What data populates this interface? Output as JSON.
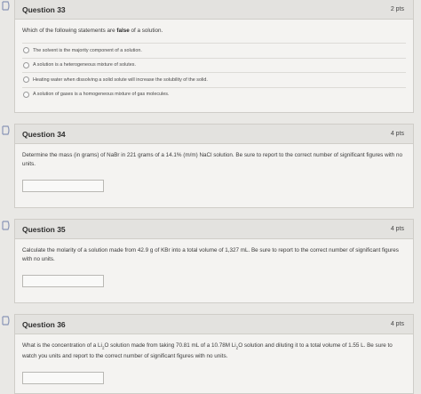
{
  "questions": [
    {
      "title": "Question 33",
      "points": "2 pts",
      "text_pre": "Which of the following statements are ",
      "text_bold": "false",
      "text_post": " of a solution.",
      "options": [
        "The solvent is the majority component of a solution.",
        "A solution is a heterogeneous mixture of solutes.",
        "Heating water when dissolving a solid solute will increase the solubility of the solid.",
        "A solution of gases is a homogeneous mixture of gas molecules."
      ]
    },
    {
      "title": "Question 34",
      "points": "4 pts",
      "text": "Determine the mass (in grams) of NaBr in 221 grams of a 14.1% (m/m) NaCl solution.  Be sure to report to the correct number of significant figures with no units."
    },
    {
      "title": "Question 35",
      "points": "4 pts",
      "text": "Calculate the molarity of a solution made from 42.9 g of KBr into a total volume of 1,327 mL.  Be sure to report to the correct number of significant figures with no units."
    },
    {
      "title": "Question 36",
      "points": "4 pts",
      "text_a": "What is the concentration of a Li",
      "sub_a": "2",
      "text_b": "O solution made from taking 70.81 mL of a 10.78M Li",
      "sub_b": "2",
      "text_c": "O solution and diluting it to a total volume of 1.55 L.  Be sure to watch you units and report to the correct number of significant figures with no units."
    }
  ],
  "colors": {
    "flag": "#8a96b8",
    "background": "#e9e8e5",
    "card": "#f4f3f1",
    "header": "#e3e2df"
  }
}
